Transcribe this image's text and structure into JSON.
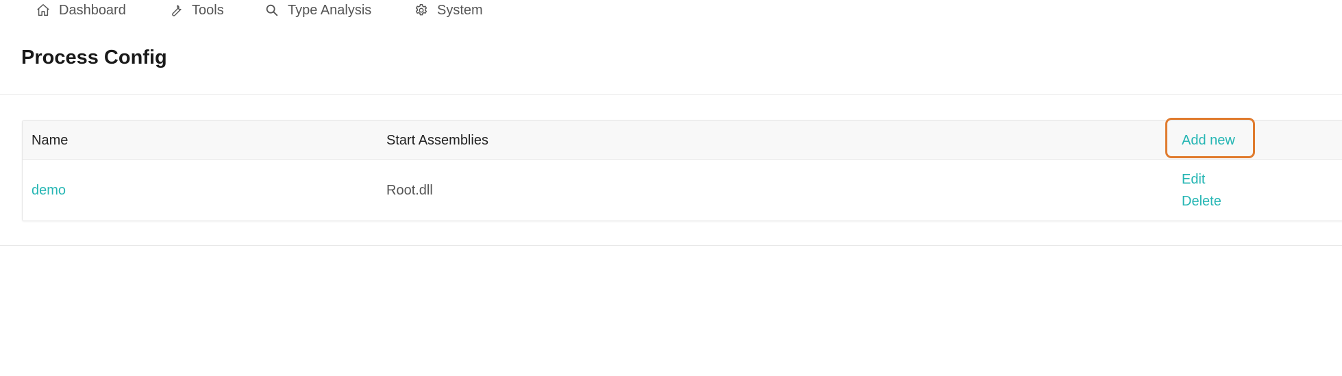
{
  "nav": {
    "items": [
      {
        "label": "Dashboard",
        "icon": "home-icon"
      },
      {
        "label": "Tools",
        "icon": "wrench-icon"
      },
      {
        "label": "Type Analysis",
        "icon": "search-icon"
      },
      {
        "label": "System",
        "icon": "gear-icon"
      }
    ]
  },
  "page": {
    "title": "Process Config"
  },
  "table": {
    "headers": {
      "name": "Name",
      "start_assemblies": "Start Assemblies",
      "add_new": "Add new"
    },
    "rows": [
      {
        "name": "demo",
        "start_assemblies": "Root.dll",
        "actions": {
          "edit": "Edit",
          "delete": "Delete"
        }
      }
    ]
  },
  "colors": {
    "accent": "#26b6b4",
    "highlight": "#e07b2e"
  }
}
